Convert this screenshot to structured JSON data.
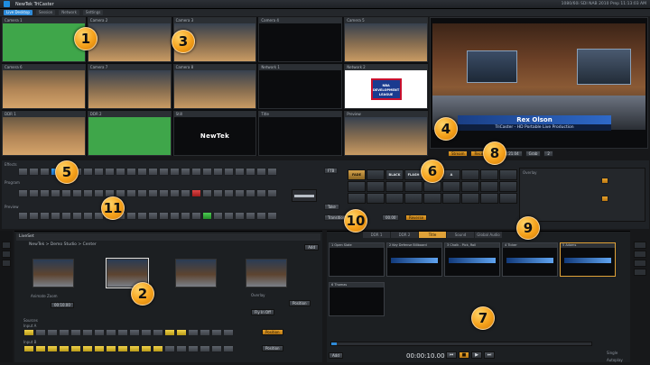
{
  "app": {
    "title": "NewTek TriCaster",
    "status": "1080/60i  SDI   NAB 2010 Prep   11:13:03 AM"
  },
  "menu": {
    "tabs": [
      "Live Desktop",
      "Session",
      "Network",
      "Settings"
    ]
  },
  "monitors": [
    {
      "label": "Camera 1",
      "scene": "green"
    },
    {
      "label": "Camera 2",
      "scene": "court"
    },
    {
      "label": "Camera 3",
      "scene": "court"
    },
    {
      "label": "Camera 4",
      "scene": "dark"
    },
    {
      "label": "Camera 5",
      "scene": "court"
    },
    {
      "label": "Camera 6",
      "scene": "bball"
    },
    {
      "label": "Camera 7",
      "scene": "court"
    },
    {
      "label": "Camera 8",
      "scene": "court"
    },
    {
      "label": "Network 1",
      "scene": "dark"
    },
    {
      "label": "Network 2",
      "scene": "nba"
    },
    {
      "label": "DDR 1",
      "scene": "bball"
    },
    {
      "label": "DDR 2",
      "scene": "green"
    },
    {
      "label": "Still",
      "scene": "newtek"
    },
    {
      "label": "Title",
      "scene": "dark"
    },
    {
      "label": "Preview",
      "scene": "court"
    }
  ],
  "nba_text": "NBA DEVELOPMENT LEAGUE",
  "newtek_text": "NewTek",
  "program": {
    "lower_third_name": "Rex Olson",
    "lower_third_title": "TriCaster - HD Portable Live Production",
    "ctl_labels": [
      "Stream",
      "Record",
      "Grab"
    ],
    "timecode": "00:04:21.04",
    "grab_count": "2"
  },
  "switcher": {
    "rows": [
      "Effects",
      "Program",
      "Preview"
    ],
    "take": "Take",
    "ftb": "FTB",
    "transition_label": "Transition"
  },
  "transitions": {
    "tiles": [
      "FADE",
      "",
      "BLACK",
      "FLASH",
      "",
      "A",
      "",
      "",
      "",
      "",
      "",
      "",
      "",
      "",
      "",
      "",
      "",
      "",
      "",
      "",
      "",
      "",
      "",
      "",
      "",
      "",
      ""
    ],
    "rate": "00.00",
    "reverse": "Reverse",
    "overlay_label": "Overlay"
  },
  "livemax": {
    "title": "LiveSet",
    "path": "NewTek > Demo Studio > Center",
    "add": "Add",
    "animate_zoom": "Animate Zoom",
    "zoom_time": "00:10.00",
    "overlay": "Overlay",
    "position": "Position",
    "fly": "Fly In Off",
    "sources_label": "Sources",
    "input_a": "Input A",
    "input_b": "Input B"
  },
  "ddr": {
    "tabs": [
      "DDR 1",
      "DDR 2",
      "Title",
      "Sound",
      "Global Audio"
    ],
    "clips": [
      {
        "label": "1 Open Slate"
      },
      {
        "label": "2 Key Defense Billboard"
      },
      {
        "label": "3 Chalk - Pick, Roll"
      },
      {
        "label": "4 Ticker"
      },
      {
        "label": "5 Adams"
      },
      {
        "label": "6 Thomas"
      }
    ],
    "timecode": "00:00:10.00",
    "add": "Add",
    "single": "Single",
    "autoplay": "Autoplay"
  },
  "callouts": [
    "1",
    "2",
    "3",
    "4",
    "5",
    "6",
    "7",
    "8",
    "9",
    "10",
    "11"
  ]
}
